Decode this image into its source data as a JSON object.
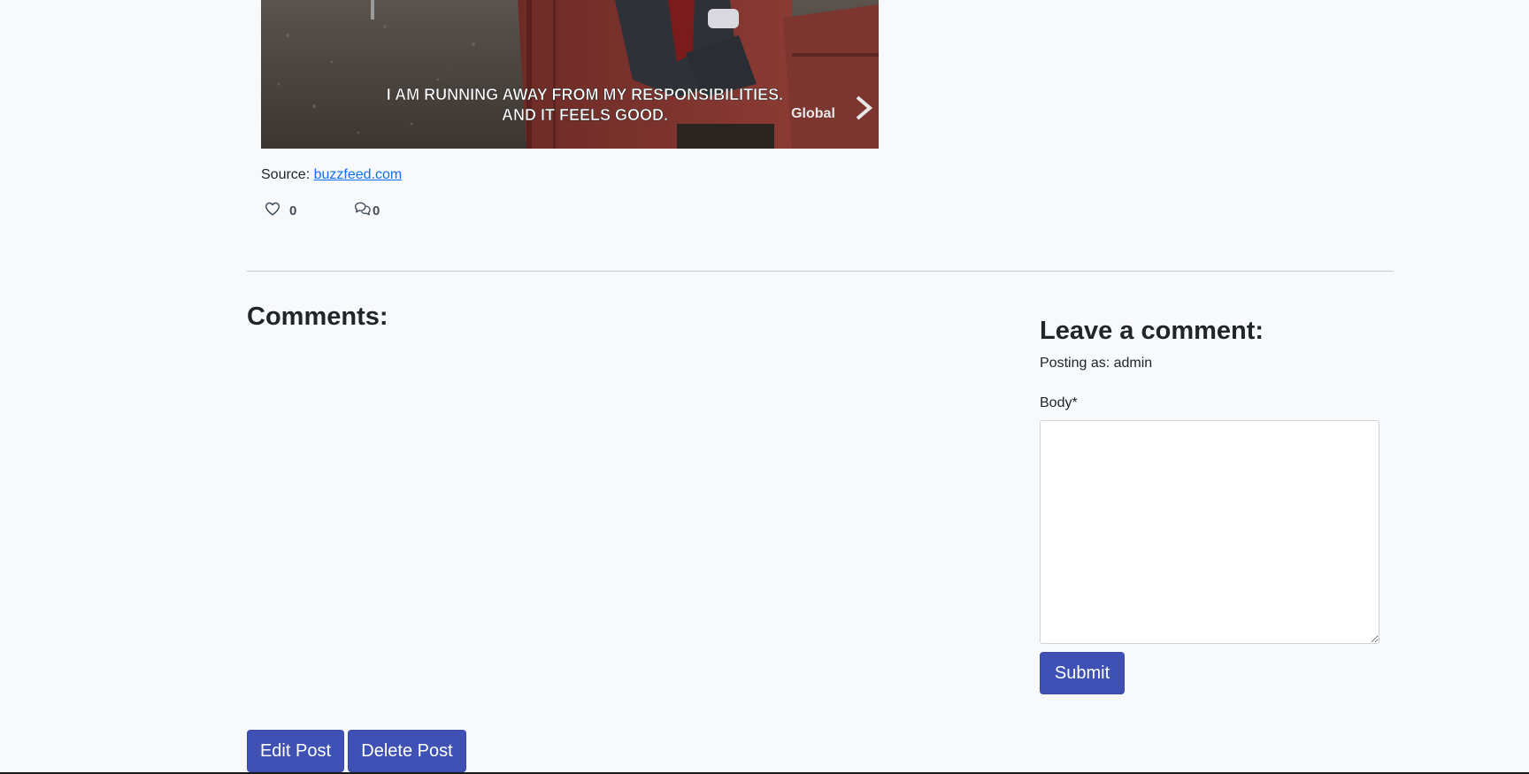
{
  "post": {
    "image_caption": {
      "line1": "I AM RUNNING AWAY FROM  MY RESPONSIBILITIES.",
      "line2": "AND IT FEELS GOOD.",
      "watermark": "Global"
    },
    "source_prefix": "Source: ",
    "source_link_text": "buzzfeed.com",
    "likes_count": "0",
    "comments_count": "0"
  },
  "comments": {
    "heading": "Comments:"
  },
  "comment_form": {
    "heading": "Leave a comment:",
    "posting_as": "Posting as: admin",
    "body_label": "Body*",
    "body_value": "",
    "submit_label": "Submit"
  },
  "actions": {
    "edit_label": "Edit Post",
    "delete_label": "Delete Post"
  },
  "colors": {
    "page_background": "#f8f9fa",
    "primary_button": "#3f51b5",
    "link": "#0d6efd"
  },
  "icons": {
    "like": "heart-icon",
    "comment": "chat-bubbles-icon",
    "watermark": "chevron-right-icon"
  }
}
